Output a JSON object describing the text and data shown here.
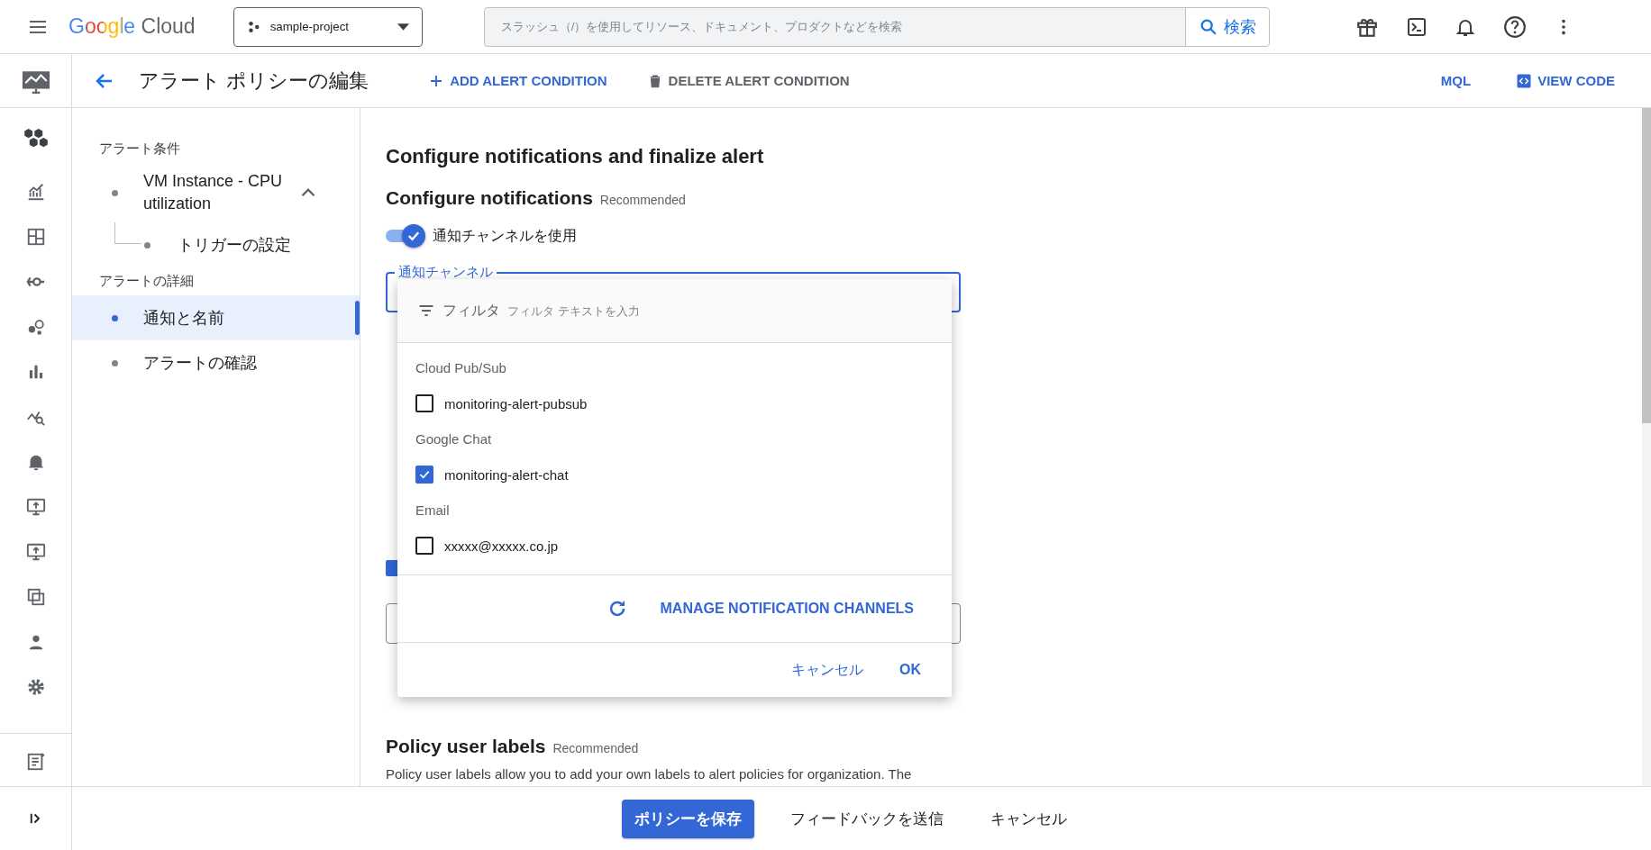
{
  "header": {
    "logo": "Google Cloud",
    "project": "sample-project",
    "search": {
      "placeholder": "スラッシュ（/）を使用してリソース、ドキュメント、プロダクトなどを検索",
      "button": "検索"
    }
  },
  "toolbar": {
    "title": "アラート ポリシーの編集",
    "actions": [
      {
        "label": "ADD ALERT CONDITION",
        "kind": "add",
        "disabled": false
      },
      {
        "label": "DELETE ALERT CONDITION",
        "kind": "delete",
        "disabled": true
      }
    ],
    "right": [
      {
        "label": "MQL",
        "kind": "text"
      },
      {
        "label": "VIEW CODE",
        "kind": "code"
      }
    ]
  },
  "nav": {
    "sections": [
      {
        "heading": "アラート条件",
        "items": [
          {
            "label": "VM Instance - CPU utilization",
            "selected": false,
            "expanded": true,
            "children": [
              {
                "label": "トリガーの設定",
                "selected": false
              }
            ]
          }
        ]
      },
      {
        "heading": "アラートの詳細",
        "items": [
          {
            "label": "通知と名前",
            "selected": true
          },
          {
            "label": "アラートの確認",
            "selected": false
          }
        ]
      }
    ]
  },
  "main": {
    "title": "Configure notifications and finalize alert",
    "notifications": {
      "heading": "Configure notifications",
      "badge": "Recommended",
      "toggle": {
        "label": "通知チャンネルを使用",
        "on": true
      },
      "channel_field": {
        "label": "通知チャンネル"
      },
      "option_checkbox": {
        "checked": true
      }
    },
    "labels_section": {
      "heading": "Policy user labels",
      "badge": "Recommended",
      "description": "Policy user labels allow you to add your own labels to alert policies for organization. The"
    }
  },
  "dropdown": {
    "filter_label": "フィルタ",
    "placeholder": "フィルタ テキストを入力",
    "groups": [
      {
        "name": "Cloud Pub/Sub",
        "channels": [
          {
            "label": "monitoring-alert-pubsub",
            "checked": false
          }
        ]
      },
      {
        "name": "Google Chat",
        "channels": [
          {
            "label": "monitoring-alert-chat",
            "checked": true
          }
        ]
      },
      {
        "name": "Email",
        "channels": [
          {
            "label": "xxxxx@xxxxx.co.jp",
            "checked": false
          }
        ]
      }
    ],
    "manage": "MANAGE NOTIFICATION CHANNELS",
    "buttons": [
      {
        "label": "キャンセル",
        "kind": "text"
      },
      {
        "label": "OK",
        "kind": "text"
      }
    ]
  },
  "footer": {
    "buttons": [
      {
        "label": "ポリシーを保存",
        "kind": "primary"
      },
      {
        "label": "フィードバックを送信",
        "kind": "text"
      },
      {
        "label": "キャンセル",
        "kind": "text"
      }
    ]
  }
}
